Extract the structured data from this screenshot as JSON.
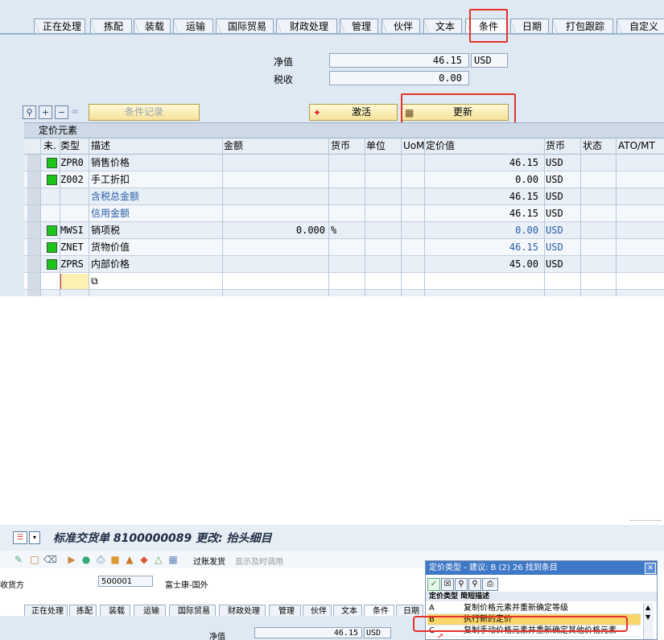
{
  "top": {
    "tabs": [
      "正在处理",
      "拣配",
      "装载",
      "运输",
      "国际贸易",
      "财政处理",
      "管理",
      "伙伴",
      "文本",
      "条件",
      "日期",
      "打包跟踪",
      "自定义"
    ],
    "active_tab": "条件",
    "net_value_label": "净值",
    "net_value": "46.15",
    "net_currency": "USD",
    "tax_label": "税收",
    "tax_value": "0.00",
    "cond_record_label": "条件记录",
    "activate_label": "激活",
    "update_label": "更新",
    "grid_title": "定价元素",
    "columns": [
      "未.",
      "类型",
      "描述",
      "金额",
      "货币",
      "单位",
      "UoM",
      "定价值",
      "货币",
      "状态",
      "ATO/MT"
    ],
    "rows": [
      {
        "status": "green",
        "type": "ZPR0",
        "desc": "销售价格",
        "amount": "",
        "amount_unit": "",
        "value": "46.15",
        "currency": "USD",
        "blue": false
      },
      {
        "status": "green",
        "type": "Z002",
        "desc": "手工折扣",
        "amount": "",
        "amount_unit": "",
        "value": "0.00",
        "currency": "USD",
        "blue": false
      },
      {
        "status": "",
        "type": "",
        "desc": "含税总金额",
        "amount": "",
        "amount_unit": "",
        "value": "46.15",
        "currency": "USD",
        "blue": false,
        "desc_blue": true
      },
      {
        "status": "",
        "type": "",
        "desc": "信用金额",
        "amount": "",
        "amount_unit": "",
        "value": "46.15",
        "currency": "USD",
        "blue": false,
        "desc_blue": true
      },
      {
        "status": "green",
        "type": "MWSI",
        "desc": "销项税",
        "amount": "0.000",
        "amount_unit": "%",
        "value": "0.00",
        "currency": "USD",
        "blue": true
      },
      {
        "status": "green",
        "type": "ZNET",
        "desc": "货物价值",
        "amount": "",
        "amount_unit": "",
        "value": "46.15",
        "currency": "USD",
        "blue": true
      },
      {
        "status": "green",
        "type": "ZPRS",
        "desc": "内部价格",
        "amount": "",
        "amount_unit": "",
        "value": "45.00",
        "currency": "USD",
        "blue": false
      }
    ]
  },
  "bottom": {
    "title": "标准交货单 8100000089 更改: 抬头细目",
    "toolbar_text1": "过账发货",
    "toolbar_text2": "显示及时调用",
    "ship_to_label": "收货方",
    "ship_to_value": "500001",
    "ship_to_name": "富士康-国外",
    "tabs": [
      "正在处理",
      "拣配",
      "装载",
      "运输",
      "国际贸易",
      "财政处理",
      "管理",
      "伙伴",
      "文本",
      "条件",
      "日期"
    ],
    "net_value_label": "净值",
    "net_value": "46.15",
    "net_currency": "USD",
    "popup": {
      "title": "定价类型 - 建议: B (2)  26 找到条目",
      "header": "定价类型 简短描述",
      "rows": [
        {
          "code": "A",
          "text": "复制价格元素并重新确定等级"
        },
        {
          "code": "B",
          "text": "执行新的定价"
        },
        {
          "code": "C",
          "text": "复制手动价格元素并重新确定其他价格元素"
        }
      ]
    }
  },
  "colors": {
    "panel_bg": "#dfe9f4",
    "highlight_red": "#e5312a",
    "status_green": "#1ec41e",
    "popup_title": "#3f78c6",
    "link_blue": "#2a5ea8"
  }
}
